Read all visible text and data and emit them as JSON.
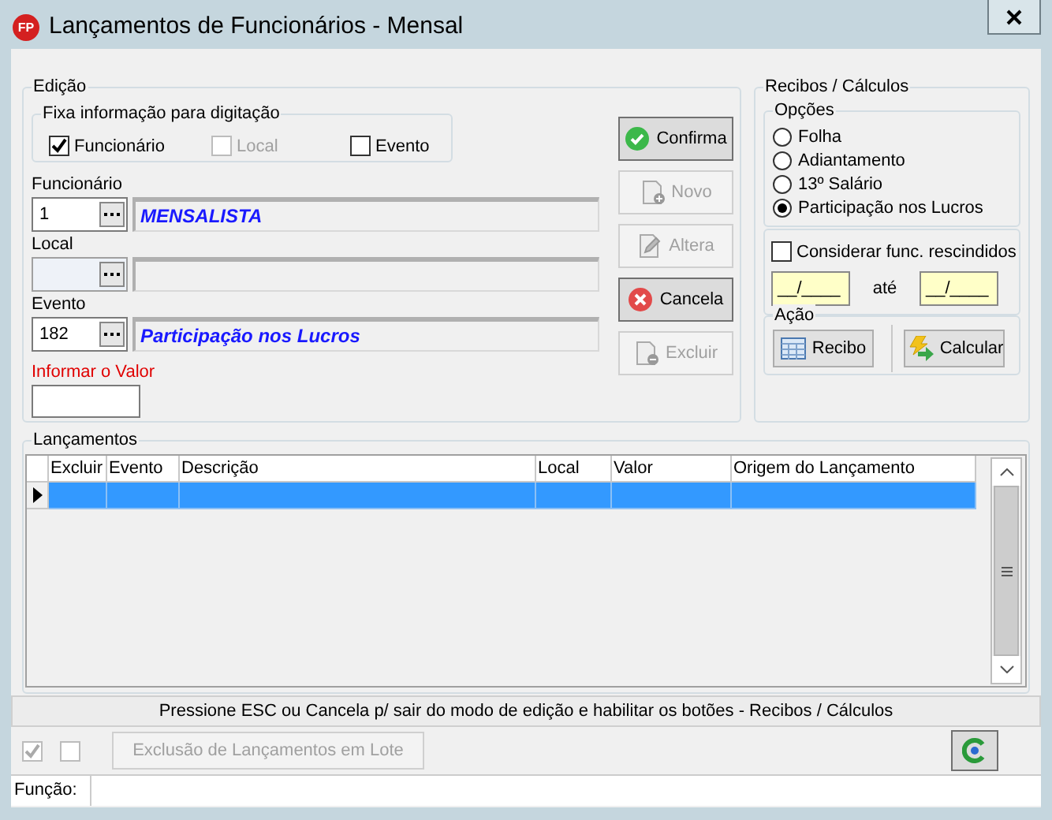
{
  "window": {
    "logo": "FP",
    "title": "Lançamentos de Funcionários - Mensal"
  },
  "edicao": {
    "title": "Edição",
    "fixa": {
      "title": "Fixa informação para digitação",
      "options": [
        {
          "label": "Funcionário",
          "checked": true,
          "disabled": false
        },
        {
          "label": "Local",
          "checked": false,
          "disabled": true
        },
        {
          "label": "Evento",
          "checked": false,
          "disabled": false
        }
      ]
    },
    "fields": [
      {
        "label": "Funcionário",
        "code": "1",
        "description": "MENSALISTA",
        "disabled": false
      },
      {
        "label": "Local",
        "disabled": true
      },
      {
        "label": "Evento",
        "code": "182",
        "description": "Participação nos Lucros",
        "disabled": false
      }
    ],
    "valor": {
      "label": "Informar o Valor"
    },
    "buttons": [
      {
        "kind": "confirm",
        "label": "Confirma",
        "disabled": false
      },
      {
        "kind": "new",
        "label": "Novo",
        "disabled": true
      },
      {
        "kind": "edit",
        "label": "Altera",
        "disabled": true
      },
      {
        "kind": "cancel",
        "label": "Cancela",
        "disabled": false
      },
      {
        "kind": "delete",
        "label": "Excluir",
        "disabled": true
      }
    ]
  },
  "recibos": {
    "title": "Recibos / Cálculos",
    "opcoes": {
      "title": "Opções",
      "options": [
        {
          "label": "Folha",
          "selected": false
        },
        {
          "label": "Adiantamento",
          "selected": false
        },
        {
          "label": "13º Salário",
          "selected": false
        },
        {
          "label": "Participação nos Lucros",
          "selected": true
        }
      ]
    },
    "considerar": {
      "label": "Considerar func. rescindidos",
      "checked": false
    },
    "periodo": {
      "from": "__/____",
      "separator": "até",
      "to": "__/____"
    },
    "acao": {
      "title": "Ação",
      "buttons": [
        {
          "kind": "recibo",
          "label": "Recibo"
        },
        {
          "kind": "calcular",
          "label": "Calcular"
        }
      ]
    }
  },
  "lancamentos": {
    "title": "Lançamentos",
    "columns": [
      "Excluir",
      "Evento",
      "Descrição",
      "Local",
      "Valor",
      "Origem do Lançamento"
    ],
    "rows": [
      {
        "selected": true
      }
    ]
  },
  "status_message": "Pressione ESC ou Cancela p/ sair do modo de edição e habilitar os botões - Recibos / Cálculos",
  "bottom": {
    "checkboxes": [
      {
        "checked": true,
        "disabled": true
      },
      {
        "checked": false,
        "disabled": true
      }
    ],
    "batch_button": {
      "label": "Exclusão de Lançamentos em Lote",
      "disabled": true
    }
  },
  "funcao": {
    "label": "Função:"
  }
}
